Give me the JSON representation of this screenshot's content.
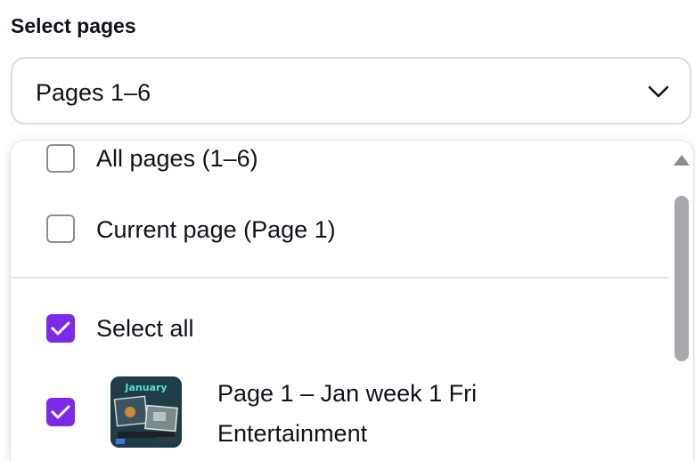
{
  "section": {
    "title": "Select pages"
  },
  "select": {
    "value": "Pages 1–6",
    "icon": "chevron-down-icon"
  },
  "dropdown": {
    "options": [
      {
        "label": "All pages (1–6)",
        "checked": false
      },
      {
        "label": "Current page (Page 1)",
        "checked": false
      }
    ],
    "select_all": {
      "label": "Select all",
      "checked": true
    },
    "pages": [
      {
        "line1": "Page 1 – Jan week 1 Fri",
        "line2": "Entertainment",
        "checked": true,
        "thumbnail_text": "January"
      }
    ]
  },
  "colors": {
    "accent": "#7d2ae8",
    "border": "#d9dce1",
    "text": "#0e1318",
    "scrollbar": "#a6a8ab"
  }
}
